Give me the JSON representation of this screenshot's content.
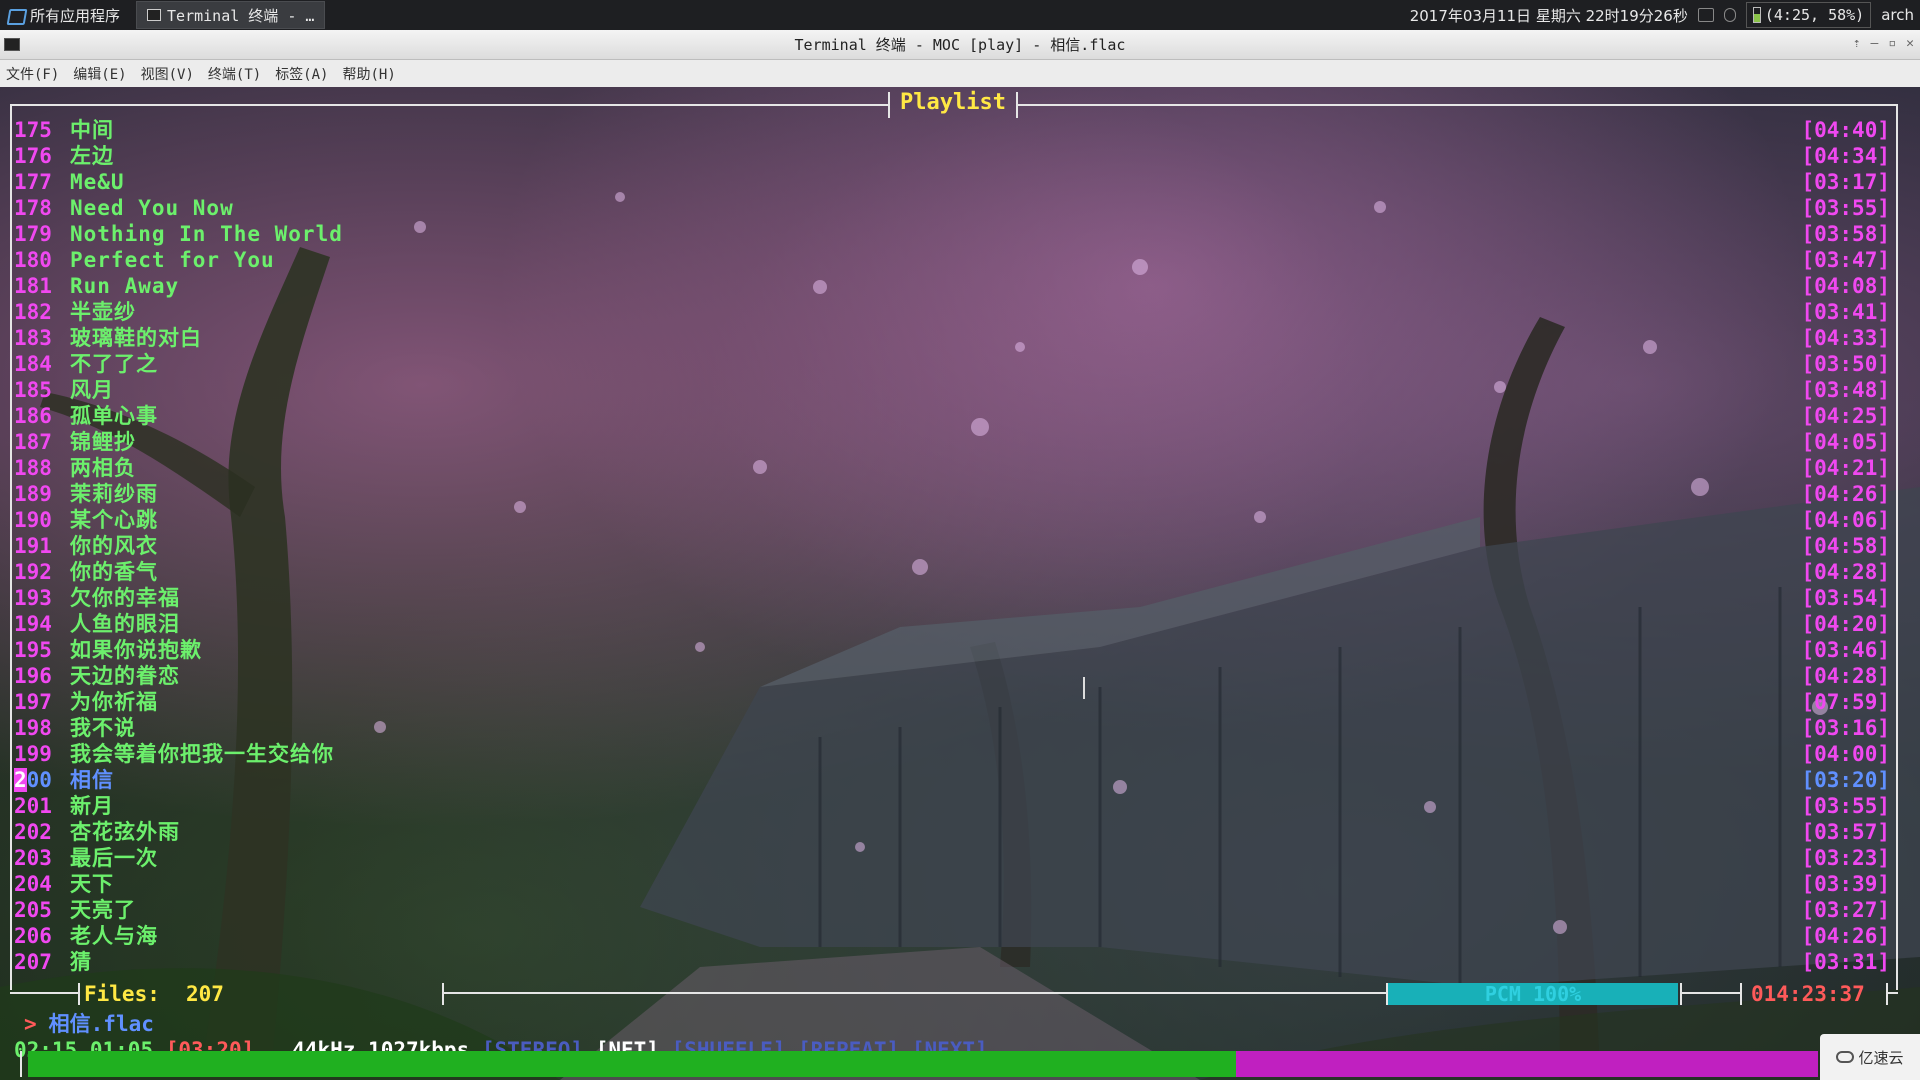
{
  "panel": {
    "apps_label": "所有应用程序",
    "task_label": "Terminal 终端 - …",
    "clock": "2017年03月11日  星期六  22时19分26秒",
    "battery": "(4:25, 58%)",
    "user": "arch"
  },
  "window": {
    "title": "Terminal 终端 - MOC [play] - 相信.flac"
  },
  "menubar": {
    "file": "文件(F)",
    "edit": "编辑(E)",
    "view": "视图(V)",
    "terminal": "终端(T)",
    "tabs": "标签(A)",
    "help": "帮助(H)"
  },
  "playlist": {
    "title": "Playlist",
    "current_index": 25,
    "items": [
      {
        "num": "175",
        "title": "中间",
        "dur": "[04:40]"
      },
      {
        "num": "176",
        "title": "左边",
        "dur": "[04:34]"
      },
      {
        "num": "177",
        "title": "Me&U",
        "dur": "[03:17]"
      },
      {
        "num": "178",
        "title": "Need You Now",
        "dur": "[03:55]"
      },
      {
        "num": "179",
        "title": "Nothing In The World",
        "dur": "[03:58]"
      },
      {
        "num": "180",
        "title": "Perfect for You",
        "dur": "[03:47]"
      },
      {
        "num": "181",
        "title": "Run Away",
        "dur": "[04:08]"
      },
      {
        "num": "182",
        "title": "半壶纱",
        "dur": "[03:41]"
      },
      {
        "num": "183",
        "title": "玻璃鞋的对白",
        "dur": "[04:33]"
      },
      {
        "num": "184",
        "title": "不了了之",
        "dur": "[03:50]"
      },
      {
        "num": "185",
        "title": "风月",
        "dur": "[03:48]"
      },
      {
        "num": "186",
        "title": "孤单心事",
        "dur": "[04:25]"
      },
      {
        "num": "187",
        "title": "锦鲤抄",
        "dur": "[04:05]"
      },
      {
        "num": "188",
        "title": "两相负",
        "dur": "[04:21]"
      },
      {
        "num": "189",
        "title": "茉莉纱雨",
        "dur": "[04:26]"
      },
      {
        "num": "190",
        "title": "某个心跳",
        "dur": "[04:06]"
      },
      {
        "num": "191",
        "title": "你的风衣",
        "dur": "[04:58]"
      },
      {
        "num": "192",
        "title": "你的香气",
        "dur": "[04:28]"
      },
      {
        "num": "193",
        "title": "欠你的幸福",
        "dur": "[03:54]"
      },
      {
        "num": "194",
        "title": "人鱼的眼泪",
        "dur": "[04:20]"
      },
      {
        "num": "195",
        "title": "如果你说抱歉",
        "dur": "[03:46]"
      },
      {
        "num": "196",
        "title": "天边的眷恋",
        "dur": "[04:28]"
      },
      {
        "num": "197",
        "title": "为你祈福",
        "dur": "[07:59]"
      },
      {
        "num": "198",
        "title": "我不说",
        "dur": "[03:16]"
      },
      {
        "num": "199",
        "title": "我会等着你把我一生交给你",
        "dur": "[04:00]"
      },
      {
        "num": "200",
        "title": "相信",
        "dur": "[03:20]"
      },
      {
        "num": "201",
        "title": "新月",
        "dur": "[03:55]"
      },
      {
        "num": "202",
        "title": "杏花弦外雨",
        "dur": "[03:57]"
      },
      {
        "num": "203",
        "title": "最后一次",
        "dur": "[03:23]"
      },
      {
        "num": "204",
        "title": "天下",
        "dur": "[03:39]"
      },
      {
        "num": "205",
        "title": "天亮了",
        "dur": "[03:27]"
      },
      {
        "num": "206",
        "title": "老人与海",
        "dur": "[04:26]"
      },
      {
        "num": "207",
        "title": "猜",
        "dur": "[03:31]"
      }
    ]
  },
  "info": {
    "files_label": "Files:",
    "files_count": "207",
    "volume": "PCM 100%",
    "volume_level": 1.0,
    "total_time": "014:23:37"
  },
  "now_playing": {
    "arrow": ">",
    "file": "相信.flac"
  },
  "status": {
    "elapsed": "02:15",
    "left": "01:05",
    "total": "[03:20]",
    "rate": "44kHz 1027kbps",
    "stereo": "[STEREO]",
    "net": "[NET]",
    "shuffle": "[SHUFFLE]",
    "repeat": "[REPEAT]",
    "next": "[NEXT]"
  },
  "progress": {
    "fraction": 0.675
  },
  "watermark": "亿速云",
  "colors": {
    "number": "#f048f0",
    "title": "#6cf06c",
    "current": "#6090ff",
    "header": "#ffe844",
    "progress_done": "#20b020",
    "progress_rest": "#c020c0"
  }
}
